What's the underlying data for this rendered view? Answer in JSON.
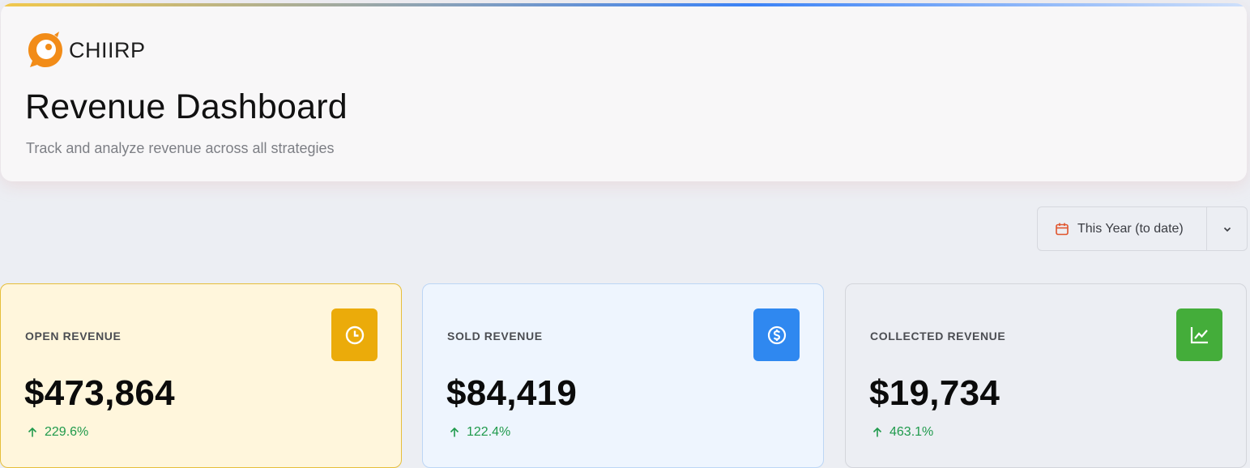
{
  "brand": {
    "name": "CHIIRP",
    "logo_icon": "chiirp-bird-logo"
  },
  "header": {
    "title": "Revenue Dashboard",
    "subtitle": "Track and analyze revenue across all strategies"
  },
  "date_filter": {
    "selected": "This Year (to date)",
    "icon": "calendar-icon",
    "toggle_icon": "chevron-down-icon"
  },
  "metrics": [
    {
      "label": "OPEN REVENUE",
      "value": "$473,864",
      "change": "229.6%",
      "trend": "up",
      "icon": "clock-icon",
      "color": "#ebab0a"
    },
    {
      "label": "SOLD REVENUE",
      "value": "$84,419",
      "change": "122.4%",
      "trend": "up",
      "icon": "dollar-circle-icon",
      "color": "#2f88f0"
    },
    {
      "label": "COLLECTED REVENUE",
      "value": "$19,734",
      "change": "463.1%",
      "trend": "up",
      "icon": "trend-chart-icon",
      "color": "#44ad3a"
    }
  ],
  "colors": {
    "accent_orange": "#f28c18",
    "positive": "#1f9a4c"
  }
}
